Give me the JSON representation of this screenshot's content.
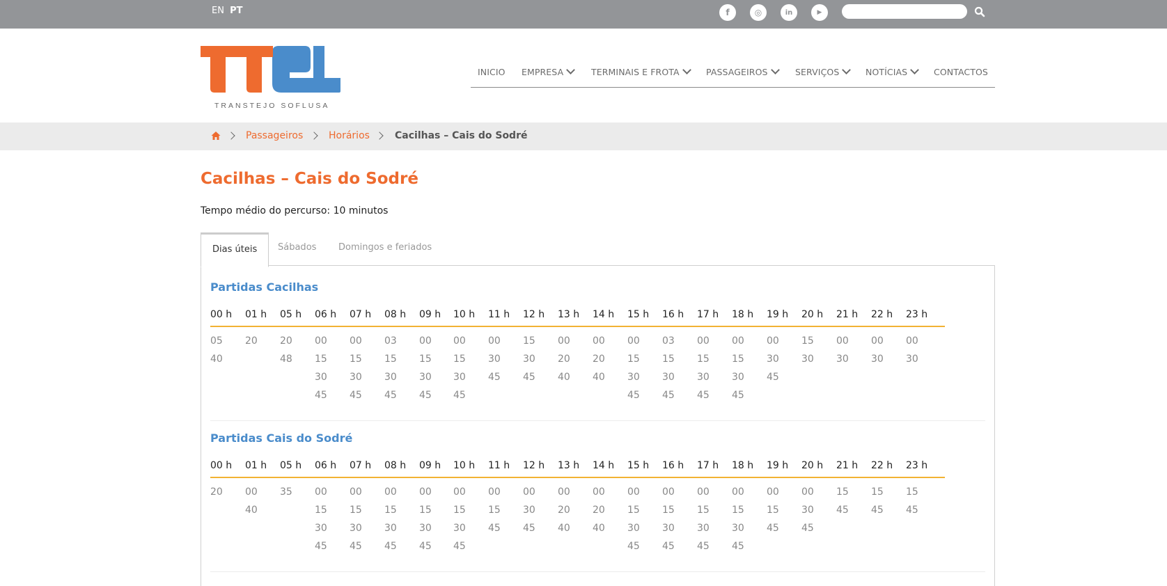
{
  "topbar": {
    "languages": [
      {
        "label": "EN",
        "active": false
      },
      {
        "label": "PT",
        "active": true
      }
    ],
    "social": [
      {
        "name": "facebook-icon",
        "glyph": "f"
      },
      {
        "name": "instagram-icon",
        "glyph": "◎"
      },
      {
        "name": "linkedin-icon",
        "glyph": "in"
      },
      {
        "name": "youtube-icon",
        "glyph": "▶"
      }
    ],
    "search_value": ""
  },
  "logo": {
    "text": "TTSL",
    "subtitle": "TRANSTEJO SOFLUSA",
    "colors": {
      "orange": "#ee6b2f",
      "blue": "#4a8ccb",
      "gray": "#666666"
    }
  },
  "nav": [
    {
      "label": "INICIO",
      "dropdown": false
    },
    {
      "label": "EMPRESA",
      "dropdown": true
    },
    {
      "label": "TERMINAIS E FROTA",
      "dropdown": true
    },
    {
      "label": "PASSAGEIROS",
      "dropdown": true
    },
    {
      "label": "SERVIÇOS",
      "dropdown": true
    },
    {
      "label": "NOTÍCIAS",
      "dropdown": true
    },
    {
      "label": "CONTACTOS",
      "dropdown": false
    }
  ],
  "breadcrumb": {
    "home_icon": "home-icon",
    "items": [
      "Passageiros",
      "Horários"
    ],
    "current": "Cacilhas – Cais do Sodré"
  },
  "page": {
    "title": "Cacilhas – Cais do Sodré",
    "route_time": "Tempo médio do percurso: 10 minutos"
  },
  "tabs": [
    {
      "label": "Dias úteis",
      "active": true
    },
    {
      "label": "Sábados",
      "active": false
    },
    {
      "label": "Domingos e feriados",
      "active": false
    }
  ],
  "schedules": [
    {
      "title": "Partidas Cacilhas",
      "hours": [
        "00 h",
        "01 h",
        "05 h",
        "06 h",
        "07 h",
        "08 h",
        "09 h",
        "10 h",
        "11 h",
        "12 h",
        "13 h",
        "14 h",
        "15 h",
        "16 h",
        "17 h",
        "18 h",
        "19 h",
        "20 h",
        "21 h",
        "22 h",
        "23 h"
      ],
      "minutes": [
        [
          "05",
          "40"
        ],
        [
          "20"
        ],
        [
          "20",
          "48"
        ],
        [
          "00",
          "15",
          "30",
          "45"
        ],
        [
          "00",
          "15",
          "30",
          "45"
        ],
        [
          "03",
          "15",
          "30",
          "45"
        ],
        [
          "00",
          "15",
          "30",
          "45"
        ],
        [
          "00",
          "15",
          "30",
          "45"
        ],
        [
          "00",
          "30",
          "45"
        ],
        [
          "15",
          "30",
          "45"
        ],
        [
          "00",
          "20",
          "40"
        ],
        [
          "00",
          "20",
          "40"
        ],
        [
          "00",
          "15",
          "30",
          "45"
        ],
        [
          "03",
          "15",
          "30",
          "45"
        ],
        [
          "00",
          "15",
          "30",
          "45"
        ],
        [
          "00",
          "15",
          "30",
          "45"
        ],
        [
          "00",
          "30",
          "45"
        ],
        [
          "15",
          "30"
        ],
        [
          "00",
          "30"
        ],
        [
          "00",
          "30"
        ],
        [
          "00",
          "30"
        ]
      ]
    },
    {
      "title": "Partidas Cais do Sodré",
      "hours": [
        "00 h",
        "01 h",
        "05 h",
        "06 h",
        "07 h",
        "08 h",
        "09 h",
        "10 h",
        "11 h",
        "12 h",
        "13 h",
        "14 h",
        "15 h",
        "16 h",
        "17 h",
        "18 h",
        "19 h",
        "20 h",
        "21 h",
        "22 h",
        "23 h"
      ],
      "minutes": [
        [
          "20"
        ],
        [
          "00",
          "40"
        ],
        [
          "35"
        ],
        [
          "00",
          "15",
          "30",
          "45"
        ],
        [
          "00",
          "15",
          "30",
          "45"
        ],
        [
          "00",
          "15",
          "30",
          "45"
        ],
        [
          "00",
          "15",
          "30",
          "45"
        ],
        [
          "00",
          "15",
          "30",
          "45"
        ],
        [
          "00",
          "15",
          "45"
        ],
        [
          "00",
          "30",
          "45"
        ],
        [
          "00",
          "20",
          "40"
        ],
        [
          "00",
          "20",
          "40"
        ],
        [
          "00",
          "15",
          "30",
          "45"
        ],
        [
          "00",
          "15",
          "30",
          "45"
        ],
        [
          "00",
          "15",
          "30",
          "45"
        ],
        [
          "00",
          "15",
          "30",
          "45"
        ],
        [
          "00",
          "15",
          "45"
        ],
        [
          "00",
          "30",
          "45"
        ],
        [
          "15",
          "45"
        ],
        [
          "15",
          "45"
        ],
        [
          "15",
          "45"
        ]
      ]
    }
  ]
}
